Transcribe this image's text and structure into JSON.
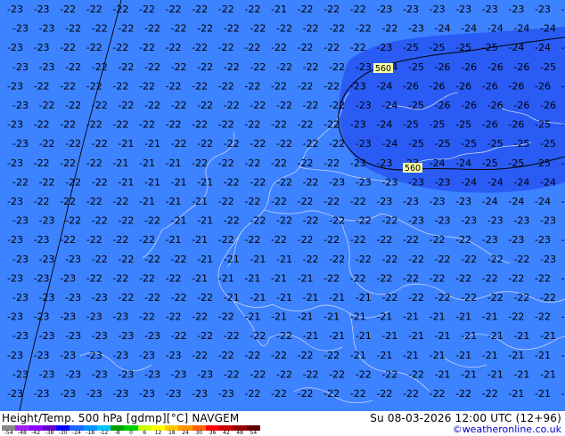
{
  "product": {
    "title": "Height/Temp. 500 hPa [gdmp][°C] NAVGEM",
    "valid_time": "Su 08-03-2026 12:00 UTC (12+96)",
    "credit": "©weatheronline.co.uk"
  },
  "contour_labels": [
    "560",
    "560"
  ],
  "legend": {
    "ticks": [
      "-54",
      "-48",
      "-42",
      "-38",
      "-30",
      "-24",
      "-18",
      "-12",
      "-8",
      "0",
      "6",
      "12",
      "18",
      "24",
      "30",
      "36",
      "42",
      "48",
      "54"
    ],
    "colors": [
      "#888888",
      "#a020f0",
      "#8b00ff",
      "#6600cc",
      "#0000ff",
      "#1e66ff",
      "#0096ff",
      "#00c8ff",
      "#00a000",
      "#00d000",
      "#c8ff00",
      "#ffff00",
      "#ffc800",
      "#ff9600",
      "#ff6400",
      "#ff0000",
      "#c80000",
      "#960000",
      "#640000"
    ]
  },
  "colors": {
    "background_field": "#3d82ff",
    "cold_core_field": "#2a5cf5",
    "boundaries": "#d7dbff",
    "contour": "#000000"
  },
  "temperature_labels": [
    [
      "-23",
      "-23",
      "-22",
      "-22",
      "-22",
      "-22",
      "-22",
      "-22",
      "-22",
      "-22",
      "-21",
      "-22",
      "-22",
      "-22",
      "-23",
      "-23",
      "-23",
      "-23",
      "-23",
      "-23",
      "-23",
      "-23"
    ],
    [
      "-23",
      "-23",
      "-22",
      "-22",
      "-22",
      "-22",
      "-22",
      "-22",
      "-22",
      "-22",
      "-22",
      "-22",
      "-22",
      "-22",
      "-22",
      "-23",
      "-24",
      "-24",
      "-24",
      "-24",
      "-24",
      "-24"
    ],
    [
      "-23",
      "-23",
      "-22",
      "-22",
      "-22",
      "-22",
      "-22",
      "-22",
      "-22",
      "-22",
      "-22",
      "-22",
      "-22",
      "-22",
      "-23",
      "-25",
      "-25",
      "-25",
      "-25",
      "-24",
      "-24",
      "-24"
    ],
    [
      "-23",
      "-23",
      "-22",
      "-22",
      "-22",
      "-22",
      "-22",
      "-22",
      "-22",
      "-22",
      "-22",
      "-22",
      "-22",
      "-23",
      "-24",
      "-25",
      "-26",
      "-26",
      "-26",
      "-26",
      "-25",
      "-24"
    ],
    [
      "-23",
      "-22",
      "-22",
      "-22",
      "-22",
      "-22",
      "-22",
      "-22",
      "-22",
      "-22",
      "-22",
      "-22",
      "-22",
      "-23",
      "-24",
      "-26",
      "-26",
      "-26",
      "-26",
      "-26",
      "-26",
      "-25"
    ],
    [
      "-23",
      "-22",
      "-22",
      "-22",
      "-22",
      "-22",
      "-22",
      "-22",
      "-22",
      "-22",
      "-22",
      "-22",
      "-22",
      "-23",
      "-24",
      "-25",
      "-26",
      "-26",
      "-26",
      "-26",
      "-26",
      "-25"
    ],
    [
      "-23",
      "-22",
      "-22",
      "-22",
      "-22",
      "-22",
      "-22",
      "-22",
      "-22",
      "-22",
      "-22",
      "-22",
      "-22",
      "-23",
      "-24",
      "-25",
      "-25",
      "-25",
      "-26",
      "-26",
      "-25",
      "-25"
    ],
    [
      "-23",
      "-22",
      "-22",
      "-22",
      "-21",
      "-21",
      "-22",
      "-22",
      "-22",
      "-22",
      "-22",
      "-22",
      "-22",
      "-23",
      "-24",
      "-25",
      "-25",
      "-25",
      "-25",
      "-25",
      "-25",
      "-25"
    ],
    [
      "-23",
      "-22",
      "-22",
      "-22",
      "-21",
      "-21",
      "-21",
      "-22",
      "-22",
      "-22",
      "-22",
      "-22",
      "-22",
      "-23",
      "-23",
      "-23",
      "-24",
      "-24",
      "-25",
      "-25",
      "-25",
      "-25"
    ],
    [
      "-22",
      "-22",
      "-22",
      "-22",
      "-21",
      "-21",
      "-21",
      "-21",
      "-22",
      "-22",
      "-22",
      "-22",
      "-23",
      "-23",
      "-23",
      "-23",
      "-23",
      "-24",
      "-24",
      "-24",
      "-24",
      "-24"
    ],
    [
      "-23",
      "-22",
      "-22",
      "-22",
      "-22",
      "-21",
      "-21",
      "-21",
      "-22",
      "-22",
      "-22",
      "-22",
      "-22",
      "-22",
      "-23",
      "-23",
      "-23",
      "-23",
      "-24",
      "-24",
      "-24",
      "-24"
    ],
    [
      "-23",
      "-23",
      "-22",
      "-22",
      "-22",
      "-22",
      "-21",
      "-21",
      "-22",
      "-22",
      "-22",
      "-22",
      "-22",
      "-22",
      "-22",
      "-23",
      "-23",
      "-23",
      "-23",
      "-23",
      "-23",
      "-23"
    ],
    [
      "-23",
      "-23",
      "-22",
      "-22",
      "-22",
      "-22",
      "-21",
      "-21",
      "-22",
      "-22",
      "-22",
      "-22",
      "-22",
      "-22",
      "-22",
      "-22",
      "-22",
      "-22",
      "-23",
      "-23",
      "-23",
      "-23"
    ],
    [
      "-23",
      "-23",
      "-23",
      "-22",
      "-22",
      "-22",
      "-22",
      "-21",
      "-21",
      "-21",
      "-21",
      "-22",
      "-22",
      "-22",
      "-22",
      "-22",
      "-22",
      "-22",
      "-22",
      "-22",
      "-23",
      "-23"
    ],
    [
      "-23",
      "-23",
      "-23",
      "-22",
      "-22",
      "-22",
      "-22",
      "-21",
      "-21",
      "-21",
      "-21",
      "-21",
      "-22",
      "-22",
      "-22",
      "-22",
      "-22",
      "-22",
      "-22",
      "-22",
      "-22",
      "-22"
    ],
    [
      "-23",
      "-23",
      "-23",
      "-23",
      "-22",
      "-22",
      "-22",
      "-22",
      "-21",
      "-21",
      "-21",
      "-21",
      "-21",
      "-21",
      "-22",
      "-22",
      "-22",
      "-22",
      "-22",
      "-22",
      "-22",
      "-22"
    ],
    [
      "-23",
      "-23",
      "-23",
      "-23",
      "-23",
      "-22",
      "-22",
      "-22",
      "-22",
      "-21",
      "-21",
      "-21",
      "-21",
      "-21",
      "-21",
      "-21",
      "-21",
      "-21",
      "-21",
      "-22",
      "-22",
      "-22"
    ],
    [
      "-23",
      "-23",
      "-23",
      "-23",
      "-23",
      "-23",
      "-22",
      "-22",
      "-22",
      "-22",
      "-22",
      "-21",
      "-21",
      "-21",
      "-21",
      "-21",
      "-21",
      "-21",
      "-21",
      "-21",
      "-21",
      "-21"
    ],
    [
      "-23",
      "-23",
      "-23",
      "-23",
      "-23",
      "-23",
      "-23",
      "-22",
      "-22",
      "-22",
      "-22",
      "-22",
      "-22",
      "-21",
      "-21",
      "-21",
      "-21",
      "-21",
      "-21",
      "-21",
      "-21",
      "-21"
    ],
    [
      "-23",
      "-23",
      "-23",
      "-23",
      "-23",
      "-23",
      "-23",
      "-23",
      "-22",
      "-22",
      "-22",
      "-22",
      "-22",
      "-22",
      "-22",
      "-22",
      "-21",
      "-21",
      "-21",
      "-21",
      "-21",
      "-21"
    ],
    [
      "-23",
      "-23",
      "-23",
      "-23",
      "-23",
      "-23",
      "-23",
      "-23",
      "-23",
      "-22",
      "-22",
      "-22",
      "-22",
      "-22",
      "-22",
      "-22",
      "-22",
      "-22",
      "-22",
      "-21",
      "-21",
      "-21"
    ]
  ]
}
